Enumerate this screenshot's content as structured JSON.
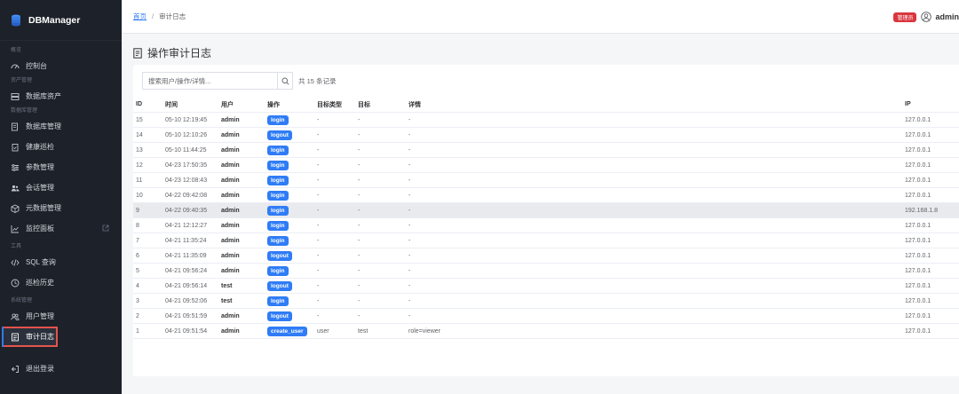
{
  "app": {
    "name": "DBManager"
  },
  "sidebar": {
    "groups": [
      {
        "label": "概览",
        "items": [
          {
            "label": "控制台",
            "icon": "dashboard-icon"
          }
        ]
      },
      {
        "label": "资产管理",
        "items": [
          {
            "label": "数据库资产",
            "icon": "server-icon"
          }
        ]
      },
      {
        "label": "数据库管理",
        "items": [
          {
            "label": "数据库管理",
            "icon": "database-list-icon"
          },
          {
            "label": "健康巡检",
            "icon": "clipboard-check-icon"
          },
          {
            "label": "参数管理",
            "icon": "sliders-icon"
          },
          {
            "label": "会话管理",
            "icon": "users-icon"
          },
          {
            "label": "元数据管理",
            "icon": "cube-icon"
          },
          {
            "label": "监控面板",
            "icon": "chart-icon",
            "external": true
          }
        ]
      },
      {
        "label": "工具",
        "items": [
          {
            "label": "SQL 查询",
            "icon": "code-icon"
          },
          {
            "label": "巡检历史",
            "icon": "clock-icon"
          }
        ]
      },
      {
        "label": "系统管理",
        "items": [
          {
            "label": "用户管理",
            "icon": "user-group-icon"
          },
          {
            "label": "审计日志",
            "icon": "audit-log-icon",
            "active": true
          }
        ]
      }
    ],
    "logout": "退出登录"
  },
  "header": {
    "breadcrumb_home": "首页",
    "breadcrumb_sep": "/",
    "breadcrumb_current": "审计日志",
    "role_badge": "管理员",
    "username": "admin"
  },
  "page": {
    "title": "操作审计日志"
  },
  "search": {
    "placeholder": "搜索用户/操作/详情...",
    "count_text": "共 15 条记录"
  },
  "table": {
    "columns": [
      "ID",
      "时间",
      "用户",
      "操作",
      "目标类型",
      "目标",
      "详情",
      "IP"
    ],
    "rows": [
      {
        "id": "15",
        "time": "05-10 12:19:45",
        "user": "admin",
        "op": "login",
        "type": "-",
        "target": "-",
        "detail": "-",
        "ip": "127.0.0.1"
      },
      {
        "id": "14",
        "time": "05-10 12:10:26",
        "user": "admin",
        "op": "logout",
        "type": "-",
        "target": "-",
        "detail": "-",
        "ip": "127.0.0.1"
      },
      {
        "id": "13",
        "time": "05-10 11:44:25",
        "user": "admin",
        "op": "login",
        "type": "-",
        "target": "-",
        "detail": "-",
        "ip": "127.0.0.1"
      },
      {
        "id": "12",
        "time": "04-23 17:50:35",
        "user": "admin",
        "op": "login",
        "type": "-",
        "target": "-",
        "detail": "-",
        "ip": "127.0.0.1"
      },
      {
        "id": "11",
        "time": "04-23 12:08:43",
        "user": "admin",
        "op": "login",
        "type": "-",
        "target": "-",
        "detail": "-",
        "ip": "127.0.0.1"
      },
      {
        "id": "10",
        "time": "04-22 09:42:08",
        "user": "admin",
        "op": "login",
        "type": "-",
        "target": "-",
        "detail": "-",
        "ip": "127.0.0.1"
      },
      {
        "id": "9",
        "time": "04-22 09:40:35",
        "user": "admin",
        "op": "login",
        "type": "-",
        "target": "-",
        "detail": "-",
        "ip": "192.168.1.8"
      },
      {
        "id": "8",
        "time": "04-21 12:12:27",
        "user": "admin",
        "op": "login",
        "type": "-",
        "target": "-",
        "detail": "-",
        "ip": "127.0.0.1"
      },
      {
        "id": "7",
        "time": "04-21 11:35:24",
        "user": "admin",
        "op": "login",
        "type": "-",
        "target": "-",
        "detail": "-",
        "ip": "127.0.0.1"
      },
      {
        "id": "6",
        "time": "04-21 11:35:09",
        "user": "admin",
        "op": "logout",
        "type": "-",
        "target": "-",
        "detail": "-",
        "ip": "127.0.0.1"
      },
      {
        "id": "5",
        "time": "04-21 09:56:24",
        "user": "admin",
        "op": "login",
        "type": "-",
        "target": "-",
        "detail": "-",
        "ip": "127.0.0.1"
      },
      {
        "id": "4",
        "time": "04-21 09:56:14",
        "user": "test",
        "op": "logout",
        "type": "-",
        "target": "-",
        "detail": "-",
        "ip": "127.0.0.1"
      },
      {
        "id": "3",
        "time": "04-21 09:52:06",
        "user": "test",
        "op": "login",
        "type": "-",
        "target": "-",
        "detail": "-",
        "ip": "127.0.0.1"
      },
      {
        "id": "2",
        "time": "04-21 09:51:59",
        "user": "admin",
        "op": "logout",
        "type": "-",
        "target": "-",
        "detail": "-",
        "ip": "127.0.0.1"
      },
      {
        "id": "1",
        "time": "04-21 09:51:54",
        "user": "admin",
        "op": "create_user",
        "type": "user",
        "target": "test",
        "detail": "role=viewer",
        "ip": "127.0.0.1"
      }
    ]
  },
  "colors": {
    "accent": "#2f7cf6",
    "sidebar_bg": "#1d2129",
    "danger": "#d9363e",
    "highlight_box": "#e5534b"
  }
}
